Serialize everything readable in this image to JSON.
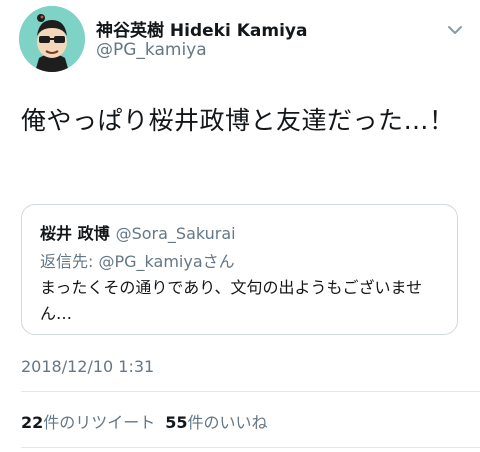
{
  "author": {
    "display_name": "神谷英樹 Hideki Kamiya",
    "handle": "@PG_kamiya",
    "avatar_icon": "sunglasses-character-avatar",
    "avatar_bg": "#7ed3c6"
  },
  "tweet": {
    "text": "俺やっぱり桜井政博と友達だった…！",
    "timestamp": "2018/12/10 1:31"
  },
  "quoted_tweet": {
    "author_name": "桜井 政博",
    "author_handle": "@Sora_Sakurai",
    "reply_prefix": "返信先: ",
    "reply_handle": "@PG_kamiya",
    "reply_suffix": "さん",
    "text": "まったくその通りであり、文句の出ようもございません…"
  },
  "stats": {
    "retweets_count": "22",
    "retweets_label": "件のリツイート",
    "likes_count": "55",
    "likes_label": "件のいいね"
  },
  "icons": {
    "menu": "chevron-down-icon"
  },
  "colors": {
    "text_primary": "#14171a",
    "text_secondary": "#657786",
    "border": "#cfd9de"
  }
}
